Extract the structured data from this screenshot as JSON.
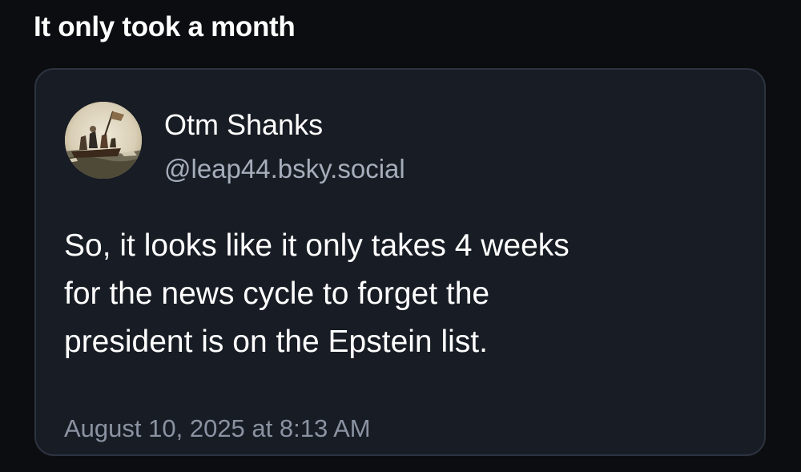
{
  "header": {
    "title": "It only took a month"
  },
  "post": {
    "author_name": "Otm Shanks",
    "author_handle": "@leap44.bsky.social",
    "avatar_icon": "painting-avatar-icon",
    "text_lines": [
      "So, it looks like it only takes 4 weeks",
      "for the news cycle to forget the",
      "president is on the Epstein list."
    ],
    "timestamp": "August 10, 2025 at 8:13 AM"
  },
  "colors": {
    "background": "#0c0d10",
    "card_background": "#181c24",
    "card_border": "#2c3340",
    "secondary_text": "#a6adbb"
  }
}
